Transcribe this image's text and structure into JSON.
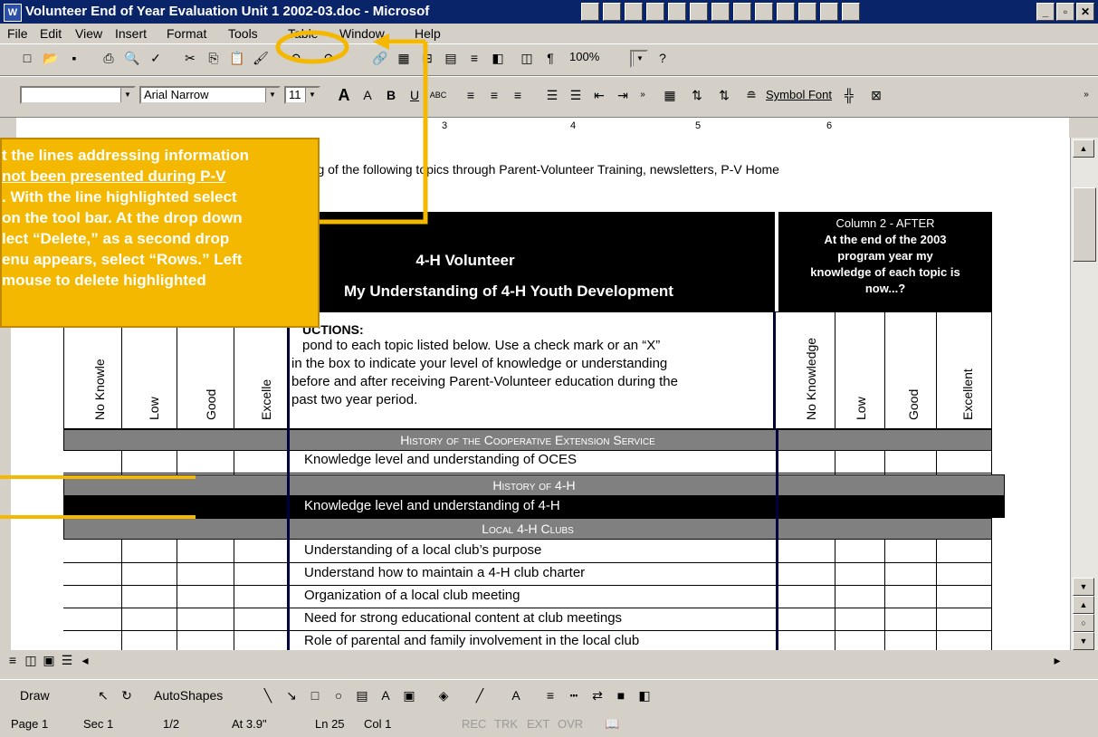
{
  "window": {
    "title": "Volunteer End of Year Evaluation Unit 1 2002-03.doc - Microsof",
    "app_icon": "W"
  },
  "menu": [
    "File",
    "Edit",
    "View",
    "Insert",
    "Format",
    "Tools",
    "Table",
    "Window",
    "Help"
  ],
  "toolbar": {
    "zoom": "100%",
    "font_name": "Arial Narrow",
    "font_size": "11",
    "symbol_font": "Symbol Font"
  },
  "ruler": {
    "marks": [
      "3",
      "4",
      "5",
      "6"
    ]
  },
  "callout": {
    "lines": [
      "t the lines addressing information",
      "not been presented during P-V",
      ". With the line highlighted select",
      "on the tool bar. At the drop down",
      "lect “Delete,” as a second drop",
      "enu appears, select “Rows.” Left",
      " mouse to delete highlighted"
    ]
  },
  "document": {
    "intro": "nding of the following topics through Parent-Volunteer Training, newsletters, P-V Home",
    "header_title": "4-H Volunteer",
    "header_subtitle": "My Understanding of 4-H Youth Development",
    "col2_lines": [
      "Column 2 - AFTER",
      "At the end of the 2003",
      "program year my",
      "knowledge of each topic is",
      "now...?"
    ],
    "instructions_head": "UCTIONS:",
    "instructions_lines": [
      "pond to each topic listed below.  Use a check mark or an “X”",
      "in the box to indicate your level of knowledge or understanding",
      "before and after receiving Parent-Volunteer education during the",
      "past two year period."
    ],
    "left_cols": [
      "No Knowle",
      "Low",
      "Good",
      "Excelle"
    ],
    "right_cols": [
      "No Knowledge",
      "Low",
      "Good",
      "Excellent"
    ],
    "sections": [
      {
        "title": "History of the Cooperative Extension Service",
        "rows": [
          "Knowledge level and understanding of OCES"
        ]
      },
      {
        "title": "History of 4-H",
        "rows": [
          "Knowledge level and understanding of 4-H"
        ]
      },
      {
        "title": "Local 4-H Clubs",
        "rows": [
          "Understanding of a local club’s purpose",
          "Understand how to maintain a 4-H club charter",
          "Organization of a local club meeting",
          "Need for strong educational content at club meetings",
          "Role of parental and family involvement in the local club"
        ]
      }
    ]
  },
  "drawbar": {
    "draw": "Draw",
    "autoshapes": "AutoShapes"
  },
  "status": {
    "page": "Page 1",
    "sec": "Sec 1",
    "pages": "1/2",
    "at": "At 3.9\"",
    "ln": "Ln 25",
    "col": "Col 1",
    "rec": "REC",
    "trk": "TRK",
    "ext": "EXT",
    "ovr": "OVR"
  },
  "colors": {
    "titlebar": "#0a246a",
    "callout": "#f5b800",
    "section": "#808080",
    "highlight_ring": "#f5b800"
  }
}
